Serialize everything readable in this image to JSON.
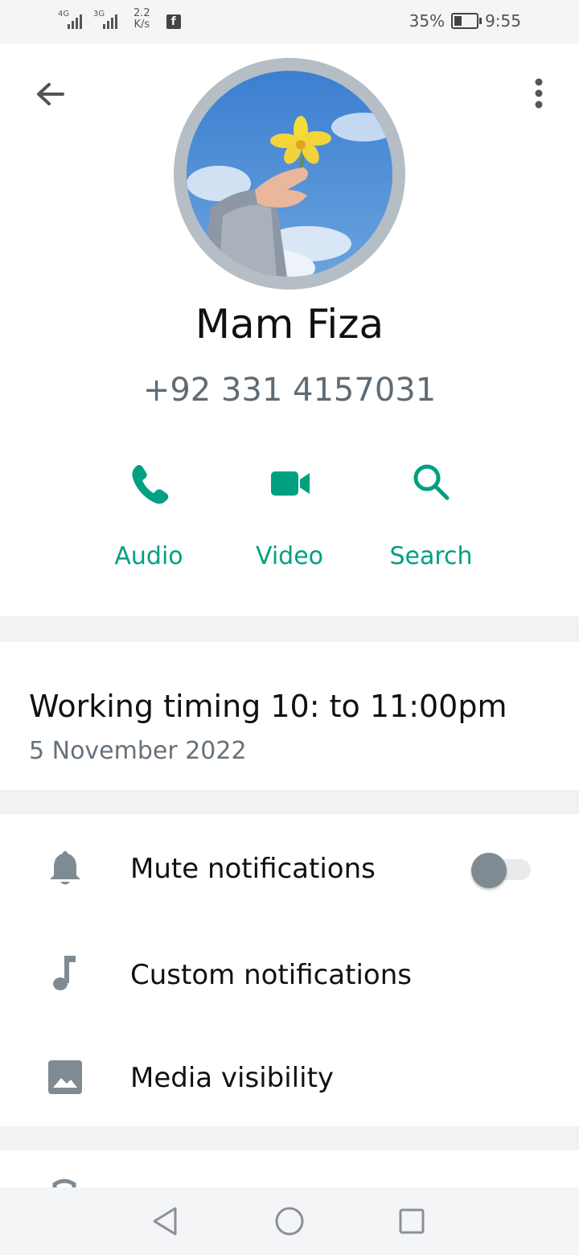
{
  "status_bar": {
    "sim1": "4G",
    "sim2": "3G",
    "speed_value": "2.2",
    "speed_unit": "K/s",
    "battery": "35%",
    "battery_level": 0.35,
    "time": "9:55"
  },
  "contact": {
    "name": "Mam Fiza",
    "phone": "+92 331 4157031"
  },
  "actions": [
    {
      "label": "Audio",
      "icon": "phone-icon"
    },
    {
      "label": "Video",
      "icon": "video-icon"
    },
    {
      "label": "Search",
      "icon": "search-icon"
    }
  ],
  "about": {
    "text": "Working timing 10: to 11:00pm",
    "date": "5 November 2022"
  },
  "settings": [
    {
      "label": "Mute notifications",
      "icon": "bell-icon",
      "toggle": false
    },
    {
      "label": "Custom notifications",
      "icon": "music-note-icon"
    },
    {
      "label": "Media visibility",
      "icon": "image-icon"
    }
  ],
  "colors": {
    "accent": "#00a080",
    "secondary_text": "#5f6b74"
  }
}
